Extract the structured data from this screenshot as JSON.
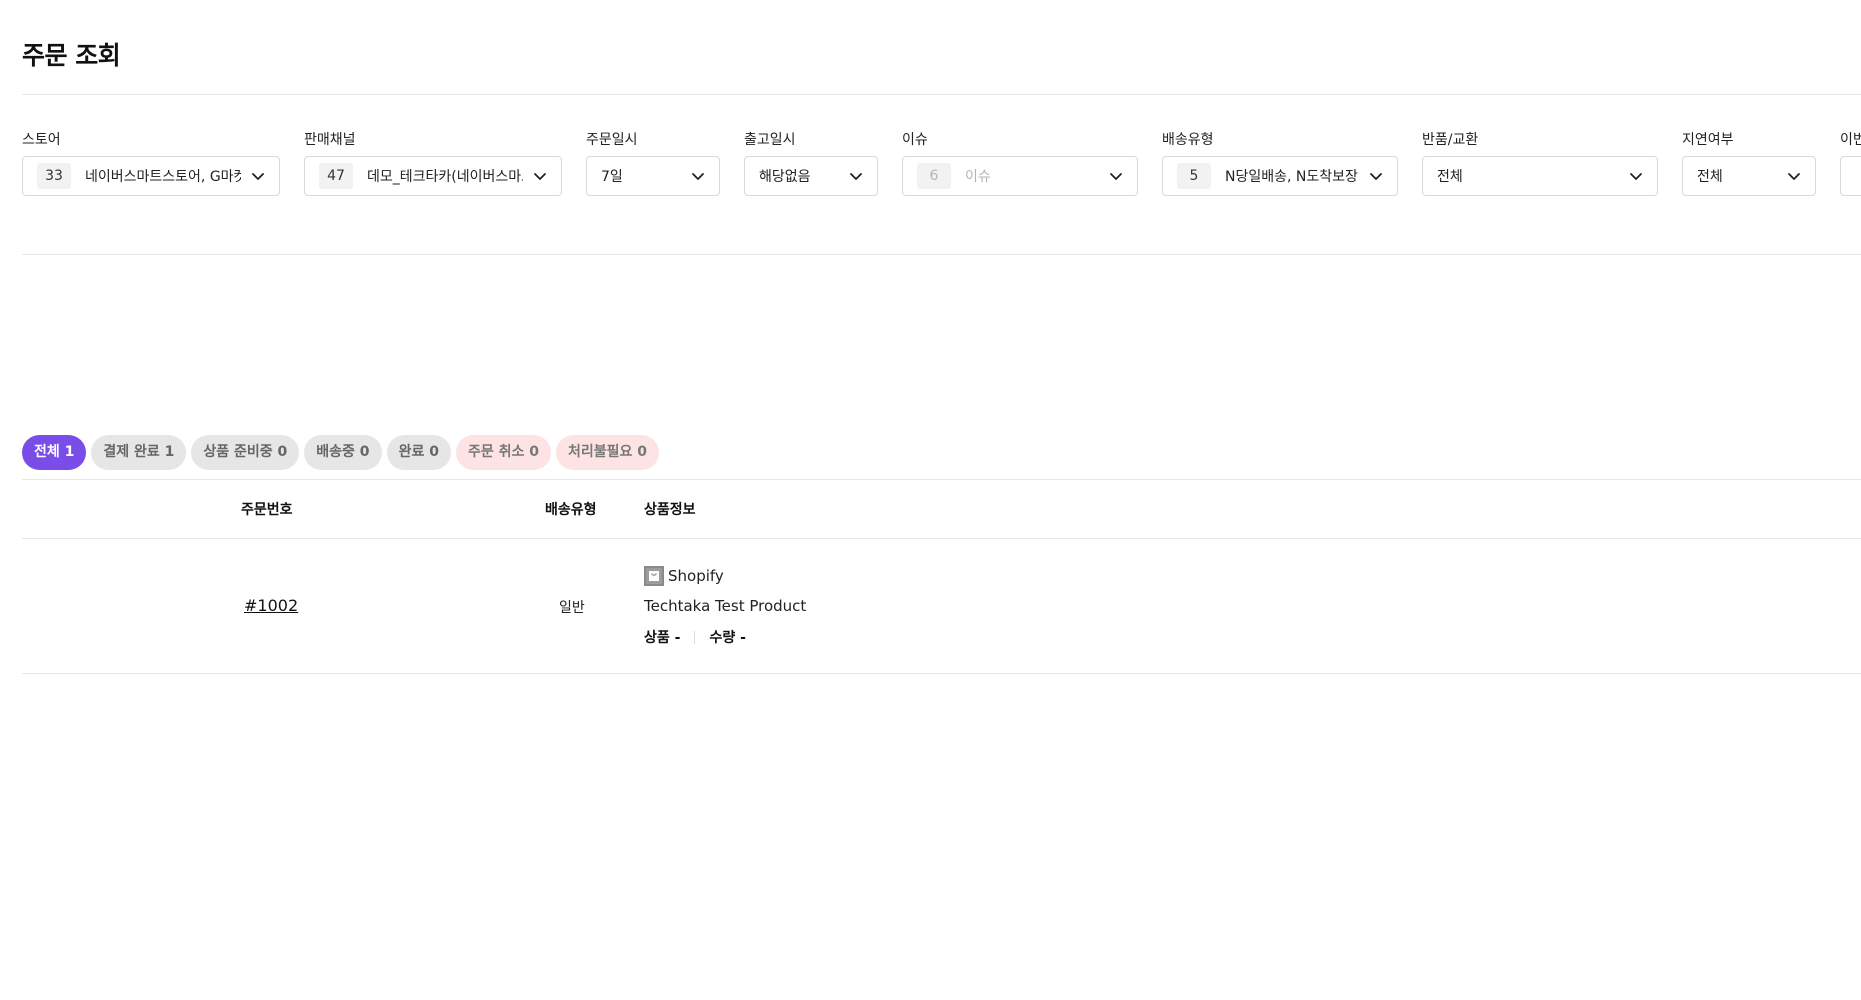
{
  "page": {
    "title": "주문 조회"
  },
  "filters": {
    "store": {
      "label": "스토어",
      "count": "33",
      "value": "네이버스마트스토어, G마켓, 옥션"
    },
    "channel": {
      "label": "판매채널",
      "count": "47",
      "value": "데모_테크타카(네이버스마트스토어)"
    },
    "order_date": {
      "label": "주문일시",
      "value": "7일"
    },
    "ship_date": {
      "label": "출고일시",
      "value": "해당없음"
    },
    "issue": {
      "label": "이슈",
      "count": "6",
      "value": "이슈"
    },
    "delivery_type": {
      "label": "배송유형",
      "count": "5",
      "value": "N당일배송, N도착보장, 일반"
    },
    "return_exchange": {
      "label": "반품/교환",
      "value": "전체"
    },
    "delay": {
      "label": "지연여부",
      "value": "전체"
    },
    "next_label": "이번"
  },
  "tabs": [
    {
      "label": "전체 1",
      "state": "active"
    },
    {
      "label": "결제 완료 1",
      "state": "normal"
    },
    {
      "label": "상품 준비중 0",
      "state": "normal"
    },
    {
      "label": "배송중 0",
      "state": "normal"
    },
    {
      "label": "완료 0",
      "state": "normal"
    },
    {
      "label": "주문 취소 0",
      "state": "danger"
    },
    {
      "label": "처리불필요 0",
      "state": "danger"
    }
  ],
  "table": {
    "headers": {
      "order_no": "주문번호",
      "delivery_type": "배송유형",
      "product_info": "상품정보"
    },
    "rows": [
      {
        "order_no": "#1002",
        "delivery_type": "일반",
        "shop": "Shopify",
        "product": "Techtaka Test Product",
        "product_code": "상품 -",
        "quantity": "수량 -"
      }
    ]
  },
  "colors": {
    "accent": "#7a4de8",
    "danger_bg": "#fde3e3",
    "neutral_bg": "#e6e6e6"
  },
  "icons": {
    "dropdown": "chevron-down-icon",
    "shop": "shopify-bag-icon"
  }
}
